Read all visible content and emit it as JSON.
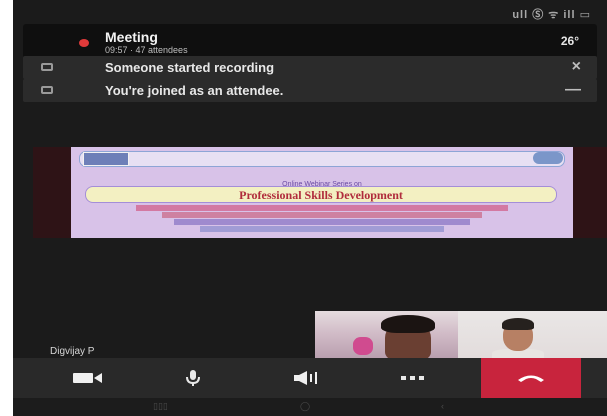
{
  "status_bar": {
    "indicators": "⁠ull Ⓢ ᯤ ⁠ill ▭"
  },
  "meeting": {
    "title": "Meeting",
    "subtitle": "09:57 · 47 attendees",
    "temperature": "26°",
    "recording_indicator_color": "#e03a3a"
  },
  "banners": {
    "recording": {
      "text": "Someone started recording",
      "close_label": "×"
    },
    "attendee": {
      "text": "You're joined as an attendee.",
      "close_label": "—"
    }
  },
  "slide": {
    "series": "Online Webinar Series on",
    "title": "Professional Skills Development"
  },
  "participant": {
    "name": "Digvijay P"
  },
  "controls": {
    "hangup_color": "#c8243d"
  }
}
